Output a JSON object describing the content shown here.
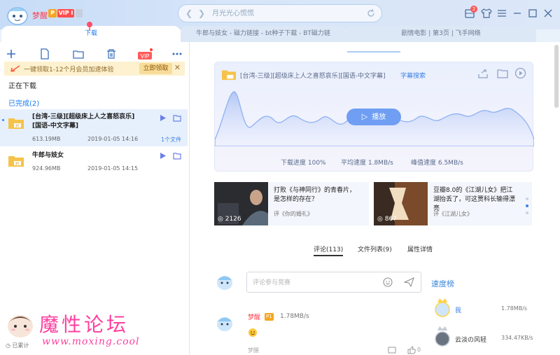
{
  "titlebar": {
    "username": "梦醒",
    "badge_p": "P",
    "badge_vip": "VIP I",
    "search_placeholder": "月光光心慌慌",
    "mail_count": "2"
  },
  "tabs": [
    {
      "label": "下载"
    },
    {
      "label": "牛郎与妓女 - 磁力链接 - bt种子下载 - BT磁力链"
    },
    {
      "label": "剧情电影 | 第3页 | 飞手网络"
    }
  ],
  "left": {
    "notice": {
      "text": "一键领取1-12个月会员加速体验",
      "button": "立即领取",
      "close": "✕"
    },
    "downloading_label": "正在下载",
    "completed_label": "已完成(2)",
    "items": [
      {
        "name_line1": "[台湾-三级][超级床上人之喜怒哀乐]",
        "name_line2": "[国语-中文字幕]",
        "size": "613.19MB",
        "date": "2019-01-05 14:16",
        "file_count": "1个文件"
      },
      {
        "name_line1": "牛郎与妓女",
        "name_line2": "",
        "size": "924.96MB",
        "date": "2019-01-05 14:15",
        "file_count": ""
      }
    ],
    "bottom_label": "已累计"
  },
  "player": {
    "title": "[台湾-三级][超级床上人之喜怒哀乐][国语-中文字幕]",
    "subtitle_link": "字幕搜索",
    "play_label": "播放",
    "progress_label": "下载进度 100%",
    "avg_speed_label": "平均速度 1.8MB/s",
    "peak_speed_label": "峰值速度 6.5MB/s"
  },
  "news": [
    {
      "text": "打败《与神同行》的青春片，是怎样的存在？",
      "source": "评《你的婚礼》",
      "views": "2126"
    },
    {
      "text": "豆瓣8.0的《江湖儿女》把江湖抬丢了，可这贾科长输得漂亮",
      "source": "评《江湖儿女》",
      "views": "867"
    }
  ],
  "detail_tabs": {
    "comments": "评论(113)",
    "files": "文件列表(9)",
    "props": "属性详情"
  },
  "comment_input": {
    "placeholder": "评论参与竞赛"
  },
  "comment": {
    "user": "梦醒",
    "level": "P1",
    "speed": "1.78MB/s",
    "footer_user": "梦醒",
    "likes": "0"
  },
  "ranking": {
    "title": "速度榜",
    "entries": [
      {
        "name": "我",
        "speed": "1.78MB/s"
      },
      {
        "name": "云淡の风轻",
        "speed": "334.47KB/s"
      }
    ]
  },
  "watermark": {
    "big": "魔性论坛",
    "url": "www.moxing.cool"
  },
  "colors": {
    "accent": "#1a7cf0",
    "player_button": "#6f9ef3",
    "waveform": "#8fb1f2",
    "watermark": "#ff3fa0"
  }
}
